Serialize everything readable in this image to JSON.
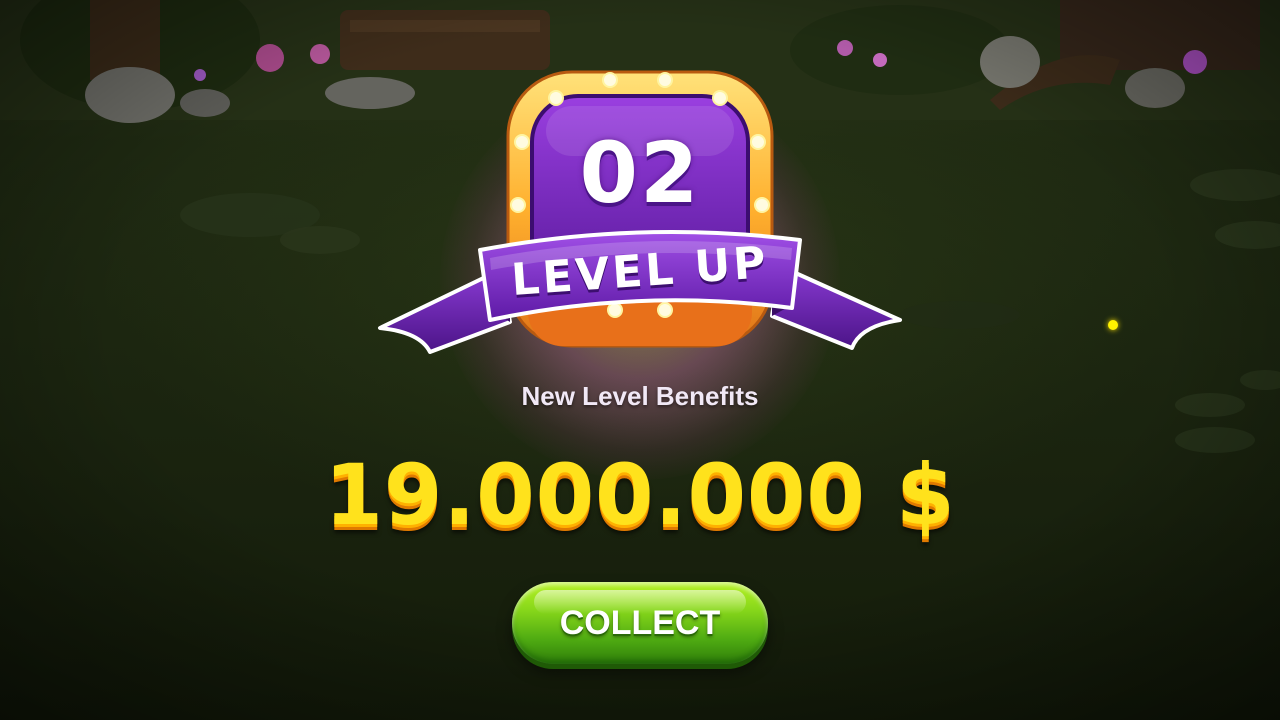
{
  "level_up": {
    "level_number": "02",
    "banner_text": "LEVEL UP",
    "subtitle": "New Level Benefits",
    "reward_amount": "19.000.000 $",
    "collect_label": "COLLECT"
  },
  "colors": {
    "badge_purple": "#7b2fc4",
    "badge_frame_gold": "#ffb02e",
    "reward_yellow": "#ffe21c",
    "button_green": "#6cc418"
  },
  "icons": [
    "marquee-bulb-icon",
    "sparkle-icon"
  ]
}
